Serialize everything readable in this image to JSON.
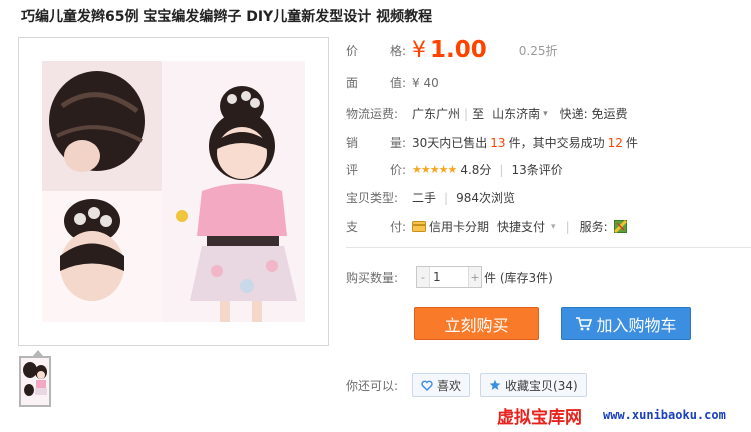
{
  "product": {
    "title": "巧编儿童发辫65例 宝宝编发编辫子 DIY儿童新发型设计 视频教程"
  },
  "price": {
    "label": "价　　格:",
    "currency": "¥",
    "value": "1.00",
    "discount": "0.25折"
  },
  "face_value": {
    "label": "面　　值:",
    "value": "¥ 40"
  },
  "shipping": {
    "label": "物流运费:",
    "from": "广东广州",
    "to_prefix": "至",
    "to": "山东济南",
    "fee": "快递: 免运费"
  },
  "sales": {
    "label": "销　　量:",
    "prefix": "30天内已售出",
    "sold": "13",
    "unit1": "件，其中交易成功",
    "success": "12",
    "unit2": "件"
  },
  "rating": {
    "label": "评　　价:",
    "stars": "★★★★★",
    "score": "4.8分",
    "reviews": "13条评价"
  },
  "type": {
    "label": "宝贝类型:",
    "condition": "二手",
    "views": "984次浏览"
  },
  "payment": {
    "label": "支　　付:",
    "card": "信用卡分期",
    "quick": "快捷支付",
    "service_label": "服务:"
  },
  "quantity": {
    "label": "购买数量:",
    "minus": "-",
    "value": "1",
    "plus": "+",
    "stock": "件 (库存3件)"
  },
  "actions": {
    "buy": "立刻购买",
    "cart": "加入购物车"
  },
  "social": {
    "label": "你还可以:",
    "like": "喜欢",
    "favorite": "收藏宝贝(34)"
  },
  "watermark": {
    "cn": "虚拟宝库网",
    "url": "www.xunibaoku.com"
  },
  "colors": {
    "accent": "#ff4400",
    "buy_button": "#f97b2a",
    "cart_button": "#3c8ee0"
  }
}
